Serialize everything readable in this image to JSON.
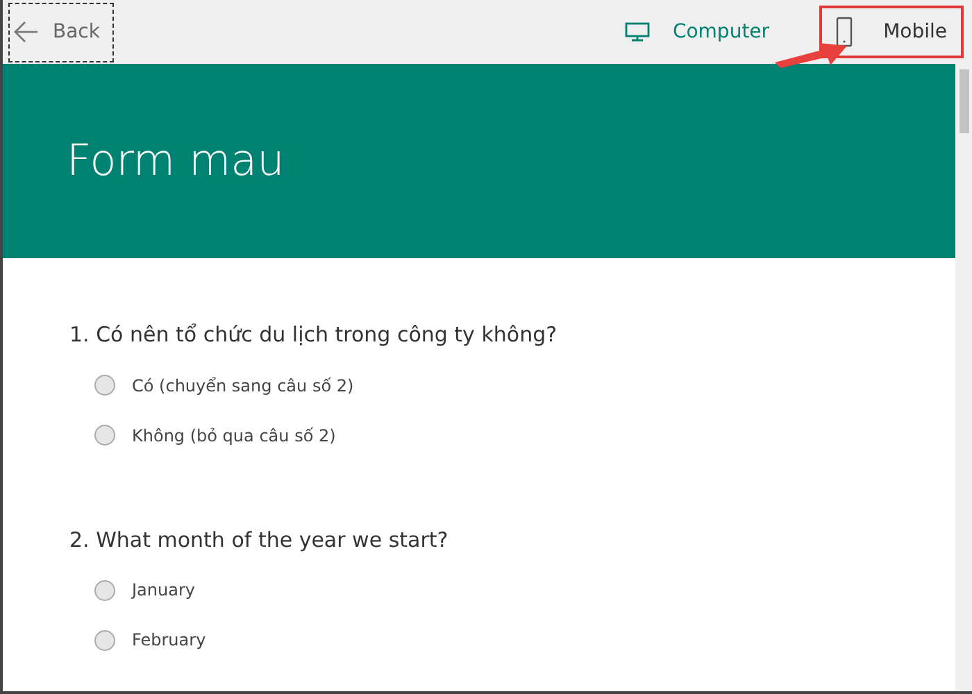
{
  "toolbar": {
    "back": "Back",
    "views": [
      {
        "label": "Computer",
        "kind": "computer",
        "selected": true
      },
      {
        "label": "Mobile",
        "kind": "mobile",
        "selected": false
      }
    ]
  },
  "form": {
    "title": "Form mau",
    "questions": [
      {
        "number": "1.",
        "text": "Có nên tổ chức du lịch trong công ty không?",
        "options": [
          {
            "label": "Có (chuyển sang câu số 2)",
            "selected": false
          },
          {
            "label": "Không (bỏ qua câu số 2)",
            "selected": false
          }
        ]
      },
      {
        "number": "2.",
        "text": "What month of the year we start?",
        "options": [
          {
            "label": "January",
            "selected": false
          },
          {
            "label": "February",
            "selected": false
          }
        ]
      }
    ]
  }
}
